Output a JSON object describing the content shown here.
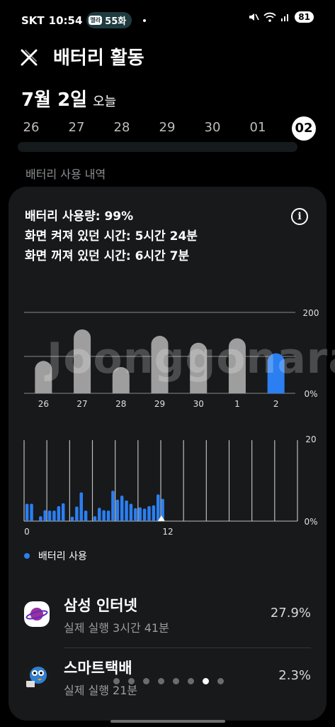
{
  "status_bar": {
    "carrier": "SKT",
    "time": "10:54",
    "notification_app": "멜라",
    "notification_text": "55화",
    "battery": "81"
  },
  "header": {
    "title": "배터리 활동"
  },
  "date": {
    "main": "7월 2일",
    "sub": "오늘"
  },
  "days": [
    "26",
    "27",
    "28",
    "29",
    "30",
    "01",
    "02"
  ],
  "selected_day_index": 6,
  "section_label": "배터리 사용 내역",
  "summary": {
    "usage": "배터리 사용량: 99%",
    "screen_on": "화면 켜져 있던 시간: 5시간 24분",
    "screen_off": "화면 꺼져 있던 시간: 6시간 7분"
  },
  "colors": {
    "bar_gray": "#9e9e9e",
    "accent_blue": "#2b7ff0",
    "card_bg": "#17191b"
  },
  "watermark": "Joonggonara",
  "chart_data": [
    {
      "type": "bar",
      "categories": [
        "26",
        "27",
        "28",
        "29",
        "30",
        "1",
        "2"
      ],
      "values": [
        80,
        158,
        65,
        142,
        125,
        136,
        99
      ],
      "highlight_index": 6,
      "y_tick_labels": [
        "200",
        "0%"
      ],
      "ylim": [
        0,
        200
      ],
      "grid": true
    },
    {
      "type": "bar",
      "x_tick_labels": [
        "0",
        "12"
      ],
      "y_tick_labels": [
        "20",
        "0%"
      ],
      "ylim": [
        0,
        20
      ],
      "values": [
        4.3,
        4.3,
        0,
        1.2,
        2.7,
        2.6,
        2.6,
        3.7,
        4.4,
        0,
        1.1,
        3.6,
        7.1,
        2.6,
        0,
        1.2,
        3.3,
        2.7,
        2.6,
        7.5,
        5.3,
        6.3,
        5.1,
        4.3,
        3.2,
        3.4,
        3.1,
        3.7,
        3.9,
        6.6,
        5.5
      ],
      "now_marker_hour": 12.3,
      "legend": "배터리 사용"
    }
  ],
  "apps": [
    {
      "name": "삼성 인터넷",
      "detail": "실제 실행 3시간 41분",
      "percent": "27.9%"
    },
    {
      "name": "스마트택배",
      "detail": "실제 실행 21분",
      "percent": "2.3%"
    }
  ],
  "page_indicator": {
    "count": 8,
    "active": 6
  }
}
